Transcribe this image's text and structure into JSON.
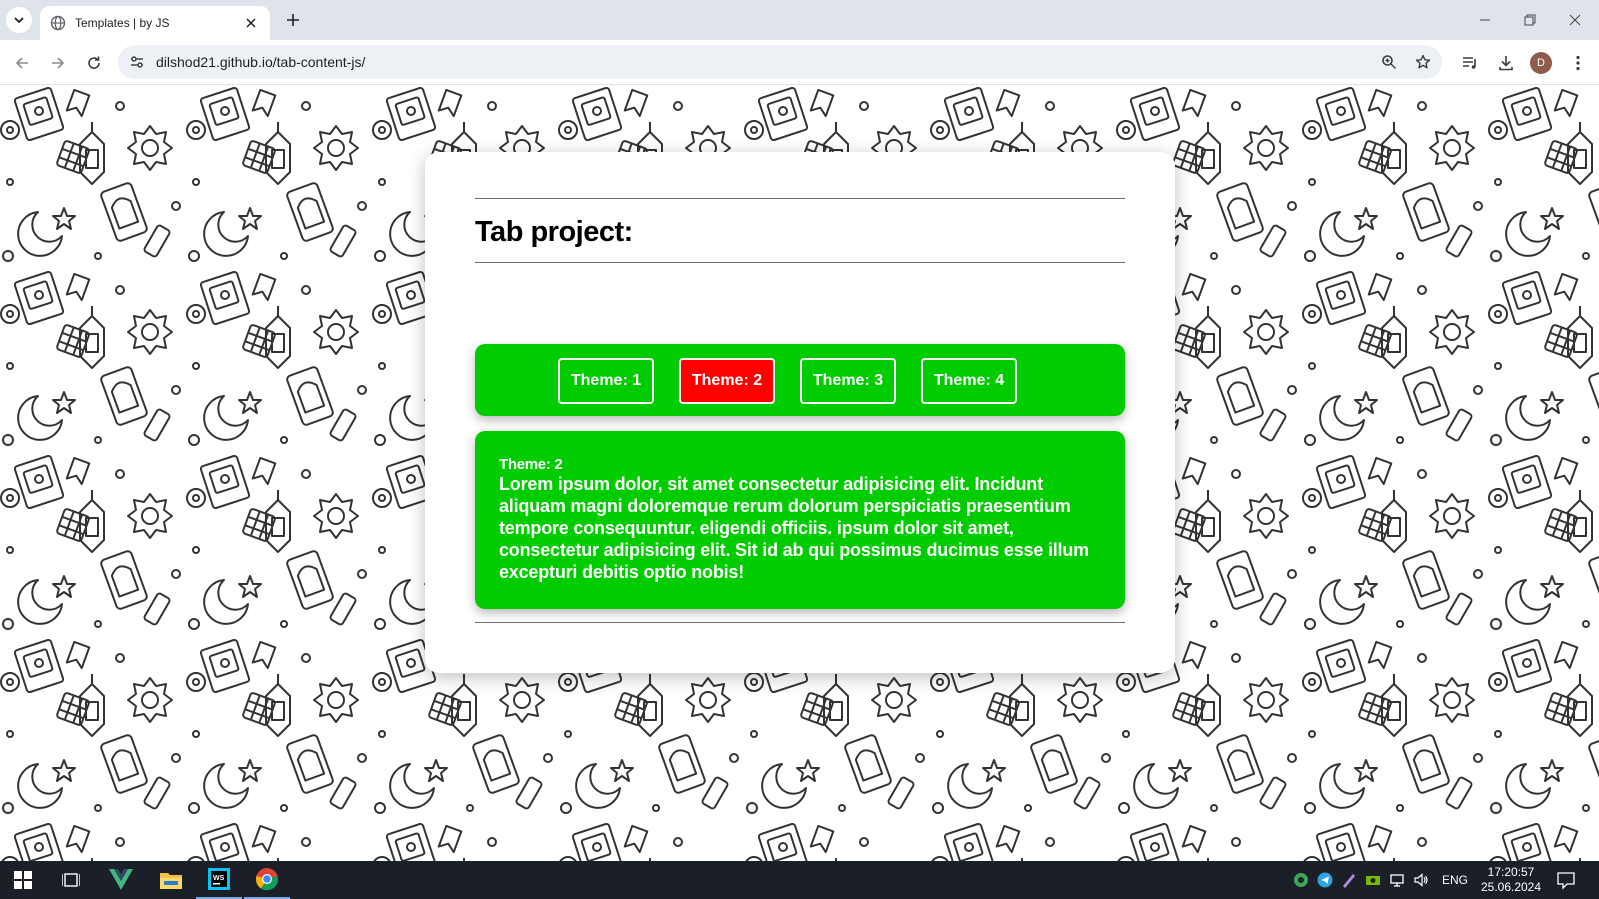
{
  "browser": {
    "tab_title": "Templates | by JS",
    "url": "dilshod21.github.io/tab-content-js/",
    "profile_initial": "D"
  },
  "page": {
    "heading": "Tab project:",
    "tabs": [
      {
        "label": "Theme: 1",
        "active": false
      },
      {
        "label": "Theme: 2",
        "active": true
      },
      {
        "label": "Theme: 3",
        "active": false
      },
      {
        "label": "Theme: 4",
        "active": false
      }
    ],
    "content": {
      "title": "Theme: 2",
      "text": "Lorem ipsum dolor, sit amet consectetur adipisicing elit. Incidunt aliquam magni doloremque rerum dolorum perspiciatis praesentium tempore consequuntur. eligendi officiis. ipsum dolor sit amet, consectetur adipisicing elit. Sit id ab qui possimus ducimus esse illum excepturi debitis optio nobis!"
    },
    "colors": {
      "panel_green": "#00cc00",
      "active_tab_red": "#ff0000",
      "text_white": "#ffffff"
    }
  },
  "taskbar": {
    "language": "ENG",
    "time": "17:20:57",
    "date": "25.06.2024"
  }
}
